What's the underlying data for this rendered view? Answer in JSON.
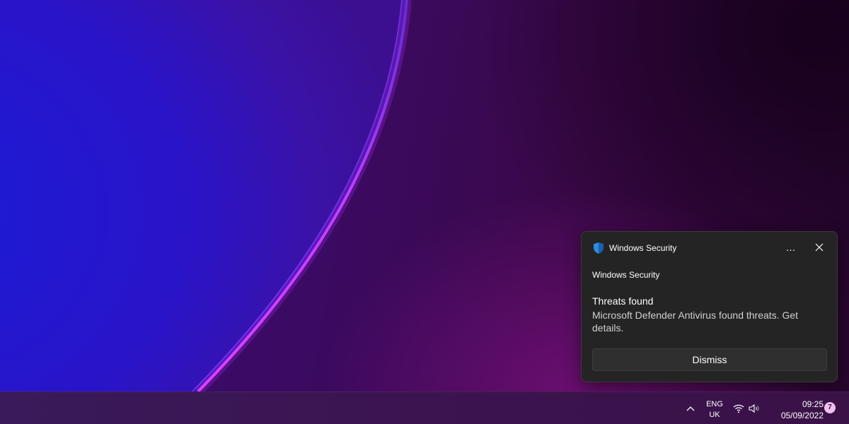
{
  "notification": {
    "app_name": "Windows Security",
    "attribution": "Windows Security",
    "title": "Threats found",
    "body": "Microsoft Defender Antivirus found threats. Get details.",
    "more_icon": "…",
    "dismiss_label": "Dismiss",
    "icons": {
      "app": "shield-icon",
      "more": "more-options-icon",
      "close": "close-icon"
    }
  },
  "taskbar": {
    "language_line1": "ENG",
    "language_line2": "UK",
    "time": "09:25",
    "date": "05/09/2022",
    "notification_count": "7",
    "icons": {
      "overflow": "chevron-up-icon",
      "network": "wifi-icon",
      "volume": "speaker-icon"
    }
  },
  "colors": {
    "toast_background": "#242424",
    "shield_blue": "#2b8de0",
    "badge": "#f0c0ee"
  }
}
